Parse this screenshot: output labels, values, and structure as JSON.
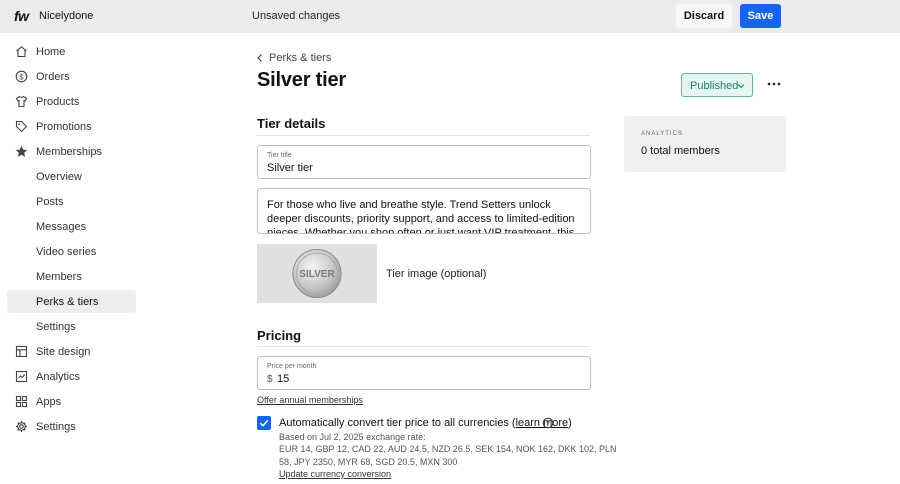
{
  "topbar": {
    "logo": "fw",
    "site_name": "Nicelydone",
    "unsaved_message": "Unsaved changes",
    "discard_label": "Discard",
    "save_label": "Save"
  },
  "sidebar": {
    "items": [
      {
        "label": "Home",
        "icon": "home-icon"
      },
      {
        "label": "Orders",
        "icon": "dollar-circle-icon"
      },
      {
        "label": "Products",
        "icon": "shirt-icon"
      },
      {
        "label": "Promotions",
        "icon": "tag-icon"
      },
      {
        "label": "Memberships",
        "icon": "star-icon"
      },
      {
        "label": "Overview"
      },
      {
        "label": "Posts"
      },
      {
        "label": "Messages"
      },
      {
        "label": "Video series"
      },
      {
        "label": "Members"
      },
      {
        "label": "Perks & tiers",
        "active": true
      },
      {
        "label": "Settings"
      },
      {
        "label": "Site design",
        "icon": "layout-icon"
      },
      {
        "label": "Analytics",
        "icon": "chart-icon"
      },
      {
        "label": "Apps",
        "icon": "apps-grid-icon"
      },
      {
        "label": "Settings",
        "icon": "gear-icon"
      }
    ]
  },
  "main": {
    "breadcrumb": "Perks & tiers",
    "title": "Silver tier",
    "status": "Published",
    "tier_details": {
      "heading": "Tier details",
      "title_label": "Tier title",
      "title_value": "Silver tier",
      "description": "For those who live and breathe style. Trend Setters unlock deeper discounts, priority support, and access to limited-edition pieces. Whether you shop often or just want VIP treatment, this is your pass to",
      "image_label": "Tier image (optional)",
      "image_badge_text": "SILVER"
    },
    "pricing": {
      "heading": "Pricing",
      "price_label": "Price per month",
      "currency_symbol": "$",
      "price_value": "15",
      "annual_link": "Offer annual memberships",
      "auto_convert_prefix": "Automatically convert tier price to all currencies (",
      "learn_more": "learn more",
      "auto_convert_suffix": ")",
      "auto_convert_checked": true,
      "rate_line1": "Based on Jul 2, 2025 exchange rate:",
      "rate_line2": "EUR 14, GBP 12, CAD 22, AUD 24.5, NZD 26.5, SEK 154, NOK 162, DKK 102, PLN",
      "rate_line3": "58, JPY 2350, MYR 68, SGD 20.5, MXN 300",
      "update_link": "Update currency conversion"
    }
  },
  "analytics": {
    "label": "ANALYTICS",
    "value": "0 total members"
  },
  "colors": {
    "accent": "#1565e8",
    "published_border": "#5fb8a6",
    "published_bg": "#e6f5f1",
    "published_text": "#1b7f6b"
  }
}
